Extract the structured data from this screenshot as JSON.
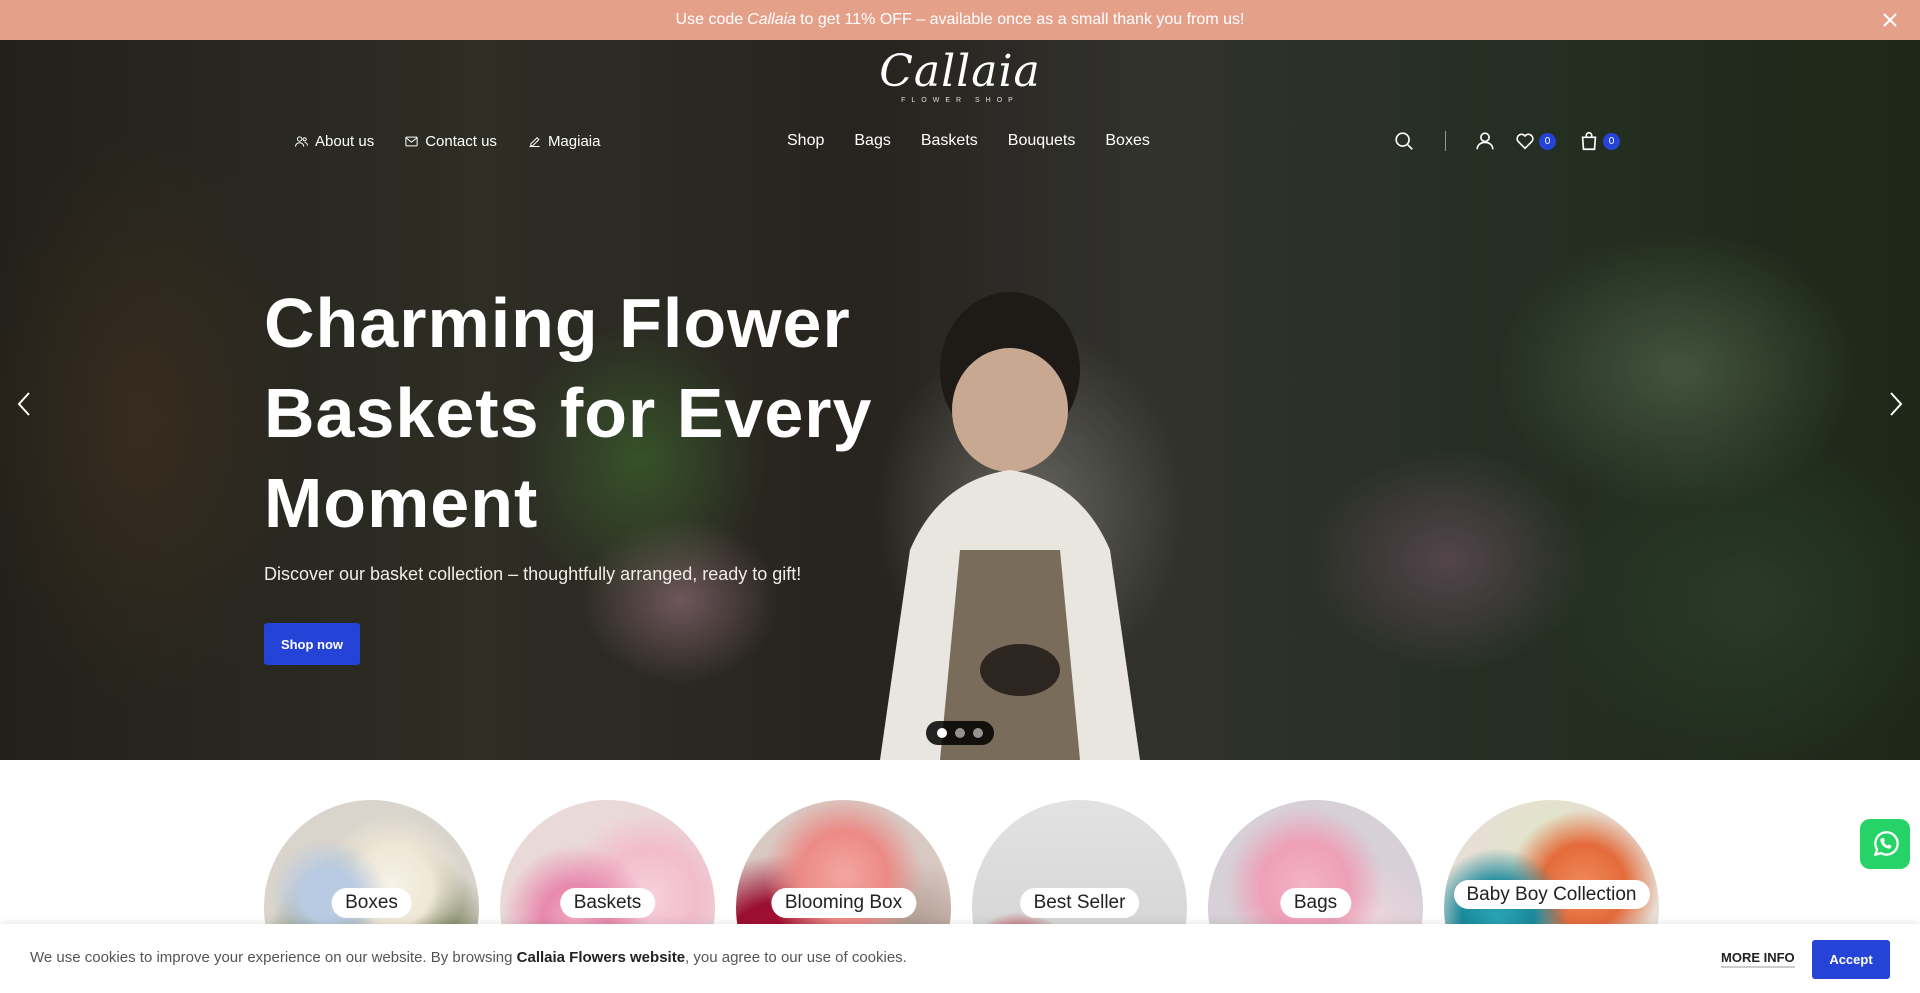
{
  "announcement": {
    "prefix": "Use code",
    "code": "Callaia",
    "suffix": "to get 11% OFF – available once as a small thank you from us!",
    "close_icon": "close-icon"
  },
  "header": {
    "logo_text": "Callaia",
    "logo_subtext": "FLOWER SHOP",
    "left_links": [
      {
        "label": "About us",
        "icon": "users-icon"
      },
      {
        "label": "Contact us",
        "icon": "mail-icon"
      },
      {
        "label": "Magiaia",
        "icon": "edit-icon"
      }
    ],
    "menu": [
      "Shop",
      "Bags",
      "Baskets",
      "Bouquets",
      "Boxes"
    ],
    "wishlist_count": "0",
    "cart_count": "0"
  },
  "hero": {
    "title": "Charming Flower Baskets for Every Moment",
    "subtitle": "Discover our basket collection – thoughtfully arranged, ready to gift!",
    "button_label": "Shop now",
    "slide_count": 3,
    "active_slide": 1
  },
  "categories": [
    {
      "label": "Boxes"
    },
    {
      "label": "Baskets"
    },
    {
      "label": "Blooming Box"
    },
    {
      "label": "Best Seller"
    },
    {
      "label": "Bags"
    },
    {
      "label": "Baby Boy Collection"
    }
  ],
  "cookie": {
    "text_before": "We use cookies to improve your experience on our website. By browsing",
    "site_name": "Callaia Flowers website",
    "text_after": ", you agree to our use of cookies.",
    "more_info_label": "MORE INFO",
    "accept_label": "Accept"
  },
  "colors": {
    "announcement_bg": "#e5a08a",
    "accent_blue": "#2643d8",
    "whatsapp_green": "#25d366"
  }
}
